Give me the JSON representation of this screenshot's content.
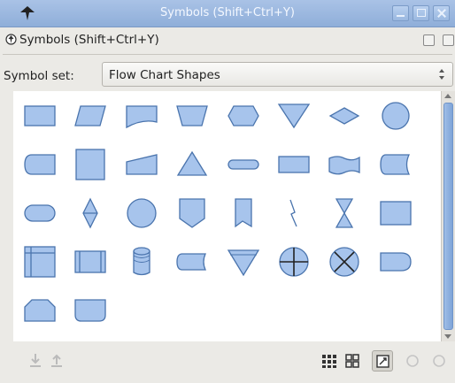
{
  "window": {
    "title": "Symbols (Shift+Ctrl+Y)",
    "icon": "inkscape-icon"
  },
  "dock": {
    "title": "Symbols (Shift+Ctrl+Y)",
    "icon": "inkscape-icon"
  },
  "symbol_set": {
    "label": "Symbol set:",
    "value": "Flow Chart Shapes"
  },
  "symbols": [
    "process",
    "data",
    "document",
    "manual-operation",
    "preparation",
    "merge",
    "sort",
    "connector",
    "delay",
    "process-square",
    "manual-input",
    "extract",
    "terminator-thin",
    "punched-tape-flat",
    "punched-tape",
    "direct-data",
    "terminator",
    "collate",
    "circle",
    "off-page-connector",
    "off-page-vertical",
    "lightning",
    "hourglass",
    "process-wide",
    "internal-storage",
    "predefined-process",
    "magnetic-disk",
    "stored-data",
    "merge-triangle",
    "summing-junction",
    "or",
    "delay-right",
    "loop-limit",
    "manual-operation-rounded"
  ],
  "toolbar": {
    "send_to_drawing_icon": "insert-symbol-icon",
    "remove_icon": "remove-symbol-icon",
    "view_large_icon": "large-tiles-icon",
    "view_small_icon": "small-tiles-icon",
    "fit_icon": "fit-symbol-icon",
    "zoom_out_icon": "zoom-out-icon",
    "zoom_in_icon": "zoom-in-icon"
  },
  "colors": {
    "shape_fill": "#a7c4ec",
    "shape_stroke": "#4a74ad",
    "titlebar": "#96b4dd"
  }
}
